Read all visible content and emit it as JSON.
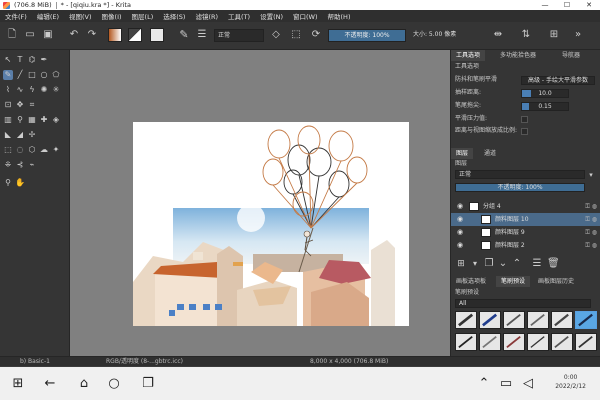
{
  "window": {
    "size_label": "(706.8 MiB)",
    "doc_title": "* - [qiqiu.kra *] - Krita",
    "minimize": "—",
    "maximize": "☐",
    "close": "✕"
  },
  "menu": [
    "文件(F)",
    "编辑(E)",
    "视图(V)",
    "图像(I)",
    "图层(L)",
    "选择(S)",
    "滤镜(R)",
    "工具(T)",
    "设置(N)",
    "窗口(W)",
    "帮助(H)"
  ],
  "toolbar": {
    "blend_mode": "正常",
    "opacity": "不透明度: 100%",
    "size": "大小: 5.00 像素"
  },
  "tool_options": {
    "tabs": [
      "工具选项",
      "多功能拾色器",
      "导航器"
    ],
    "header": "工具选项",
    "smoothing_label": "防抖和笔刷平滑",
    "smoothing_value": "高级 - 手绘大平滑参数",
    "distance_label": "抽样距离:",
    "distance_value": "10.0",
    "distance_fill": 0.2,
    "tail_label": "笔尾拖尖:",
    "tail_value": "0.15",
    "tail_fill": 0.15,
    "pressure_label": "平滑压力值:",
    "scalable_label": "距离与视图缩放成比例:"
  },
  "layers_panel": {
    "tabs": [
      "图层",
      "通道"
    ],
    "header": "图层",
    "blend_mode": "正常",
    "opacity": "不透明度:  100%",
    "layers": [
      {
        "name": "分组 4"
      },
      {
        "name": "颜料图层 10"
      },
      {
        "name": "颜料图层 9"
      },
      {
        "name": "颜料图层 2"
      }
    ],
    "footer_tabs": [
      "画板选项板",
      "笔刷预设",
      "画板图层历史"
    ]
  },
  "brush_presets": {
    "header": "笔刷预设",
    "filter": "All"
  },
  "statusbar": {
    "brush": "b) Basic-1",
    "colorspace": "RGB/透明度 (8-...gbtrc.icc)",
    "dims": "8,000 x 4,000 (706.8 MiB)"
  },
  "taskbar": {
    "time": "0:00",
    "date": "2022/2/12"
  },
  "colors": {
    "accent": "#5aa7e4",
    "selected_layer": "#4a6a8a",
    "canvas_bg": "#808080"
  }
}
